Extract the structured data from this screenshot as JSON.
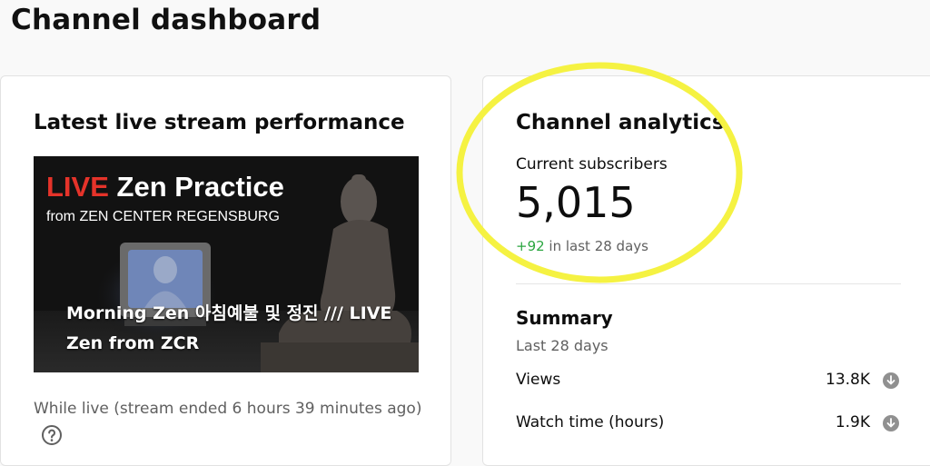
{
  "page": {
    "title": "Channel dashboard"
  },
  "live_card": {
    "title": "Latest live stream performance",
    "thumbnail": {
      "live_word": "LIVE",
      "headline": "Zen Practice",
      "subheadline": "from ZEN CENTER REGENSBURG",
      "caption": "Morning Zen 아침예불 및 정진 /// LIVE Zen from ZCR"
    },
    "status_text": "While live (stream ended 6 hours 39 minutes ago)",
    "help_icon": "help-circle-icon"
  },
  "analytics_card": {
    "title": "Channel analytics",
    "subscribers_label": "Current subscribers",
    "subscribers_count": "5,015",
    "subscribers_delta": "+92",
    "subscribers_delta_suffix": " in last 28 days",
    "summary_title": "Summary",
    "summary_period": "Last 28 days",
    "metrics": [
      {
        "name": "Views",
        "value": "13.8K",
        "trend": "down",
        "icon": "arrow-down-circle-icon"
      },
      {
        "name": "Watch time (hours)",
        "value": "1.9K",
        "trend": "down",
        "icon": "arrow-down-circle-icon"
      }
    ]
  },
  "colors": {
    "live_red": "#e5332a",
    "positive_green": "#2ba640",
    "highlight_yellow": "#f5f242"
  }
}
